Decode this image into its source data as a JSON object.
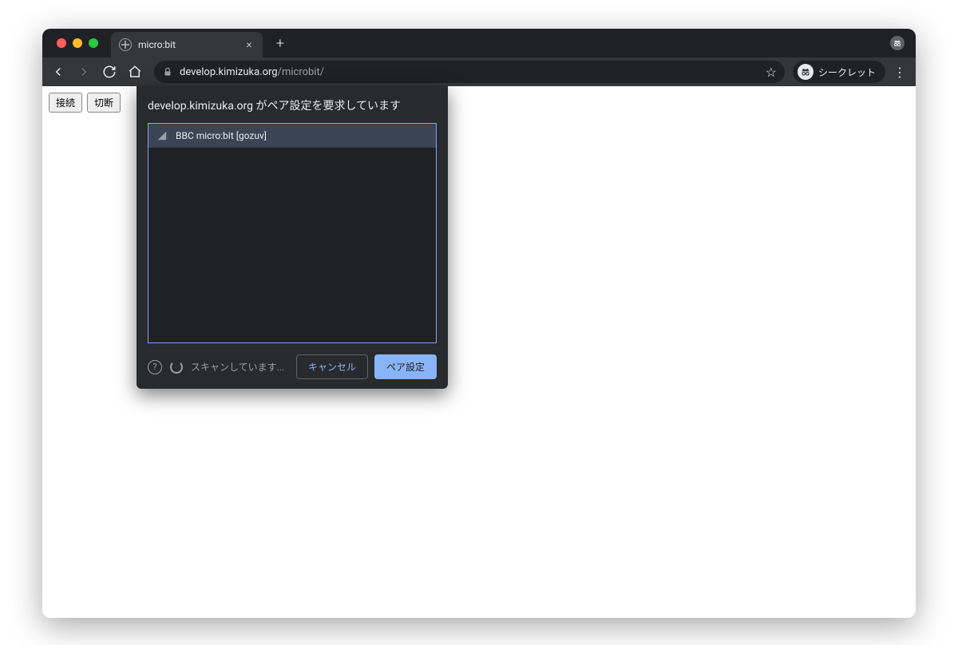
{
  "tab": {
    "title": "micro:bit"
  },
  "toolbar": {
    "url_host": "develop.kimizuka.org",
    "url_path": "/microbit/",
    "incognito_label": "シークレット"
  },
  "page": {
    "connect_label": "接続",
    "disconnect_label": "切断"
  },
  "bt_dialog": {
    "title": "develop.kimizuka.org がペア設定を要求しています",
    "devices": [
      {
        "name": "BBC micro:bit [gozuv]"
      }
    ],
    "scanning_label": "スキャンしています...",
    "cancel_label": "キャンセル",
    "pair_label": "ペア設定"
  }
}
